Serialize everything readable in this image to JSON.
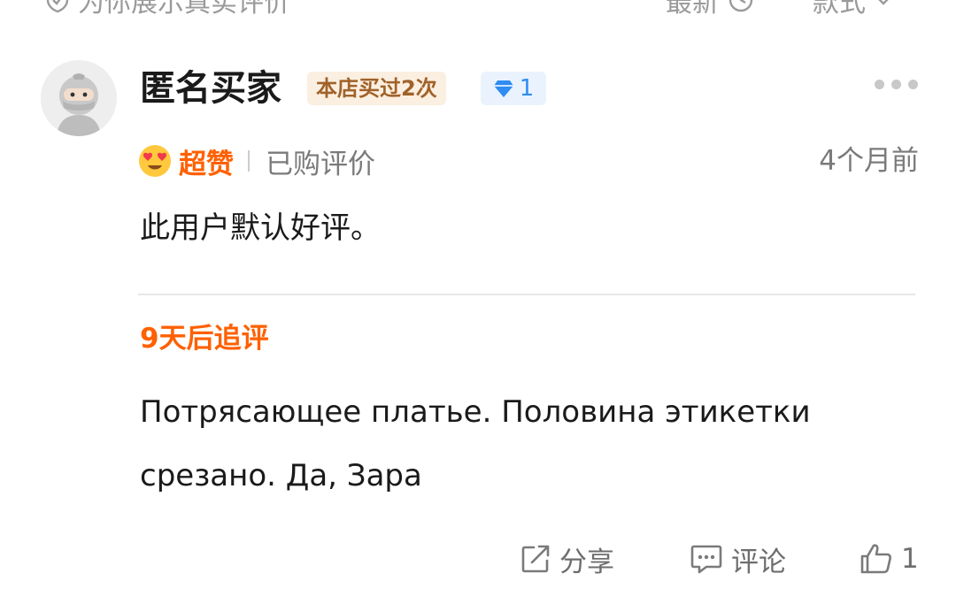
{
  "topbar": {
    "left_label": "为你展示真实评价",
    "sort_latest": "最新",
    "sort_style": "款式"
  },
  "review": {
    "username": "匿名买家",
    "store_badge": "本店买过2次",
    "level": "1",
    "rating": "超赞",
    "purchased_label": "已购评价",
    "time_ago": "4个月前",
    "content": "此用户默认好评。"
  },
  "followup": {
    "title": "9天后追评",
    "content": "Потрясающее платье. Половина этикетки\nсрезано. Да, Зара"
  },
  "actions": {
    "share": "分享",
    "comment": "评论",
    "like_count": "1"
  },
  "colors": {
    "accent_orange": "#ff6000",
    "badge_brown": "#a0622a",
    "badge_bg": "#fbefe1",
    "level_blue": "#2f8cf2",
    "level_bg": "#eaf3fd"
  },
  "icons": {
    "top_left": "shield-check-icon",
    "sort_latest": "clock-icon",
    "sort_style": "chevron-down-icon",
    "level": "diamond-icon",
    "more": "more-dots-icon",
    "rating": "heart-eyes-emoji-icon",
    "share": "share-icon",
    "comment": "comment-icon",
    "like": "thumbs-up-icon"
  }
}
